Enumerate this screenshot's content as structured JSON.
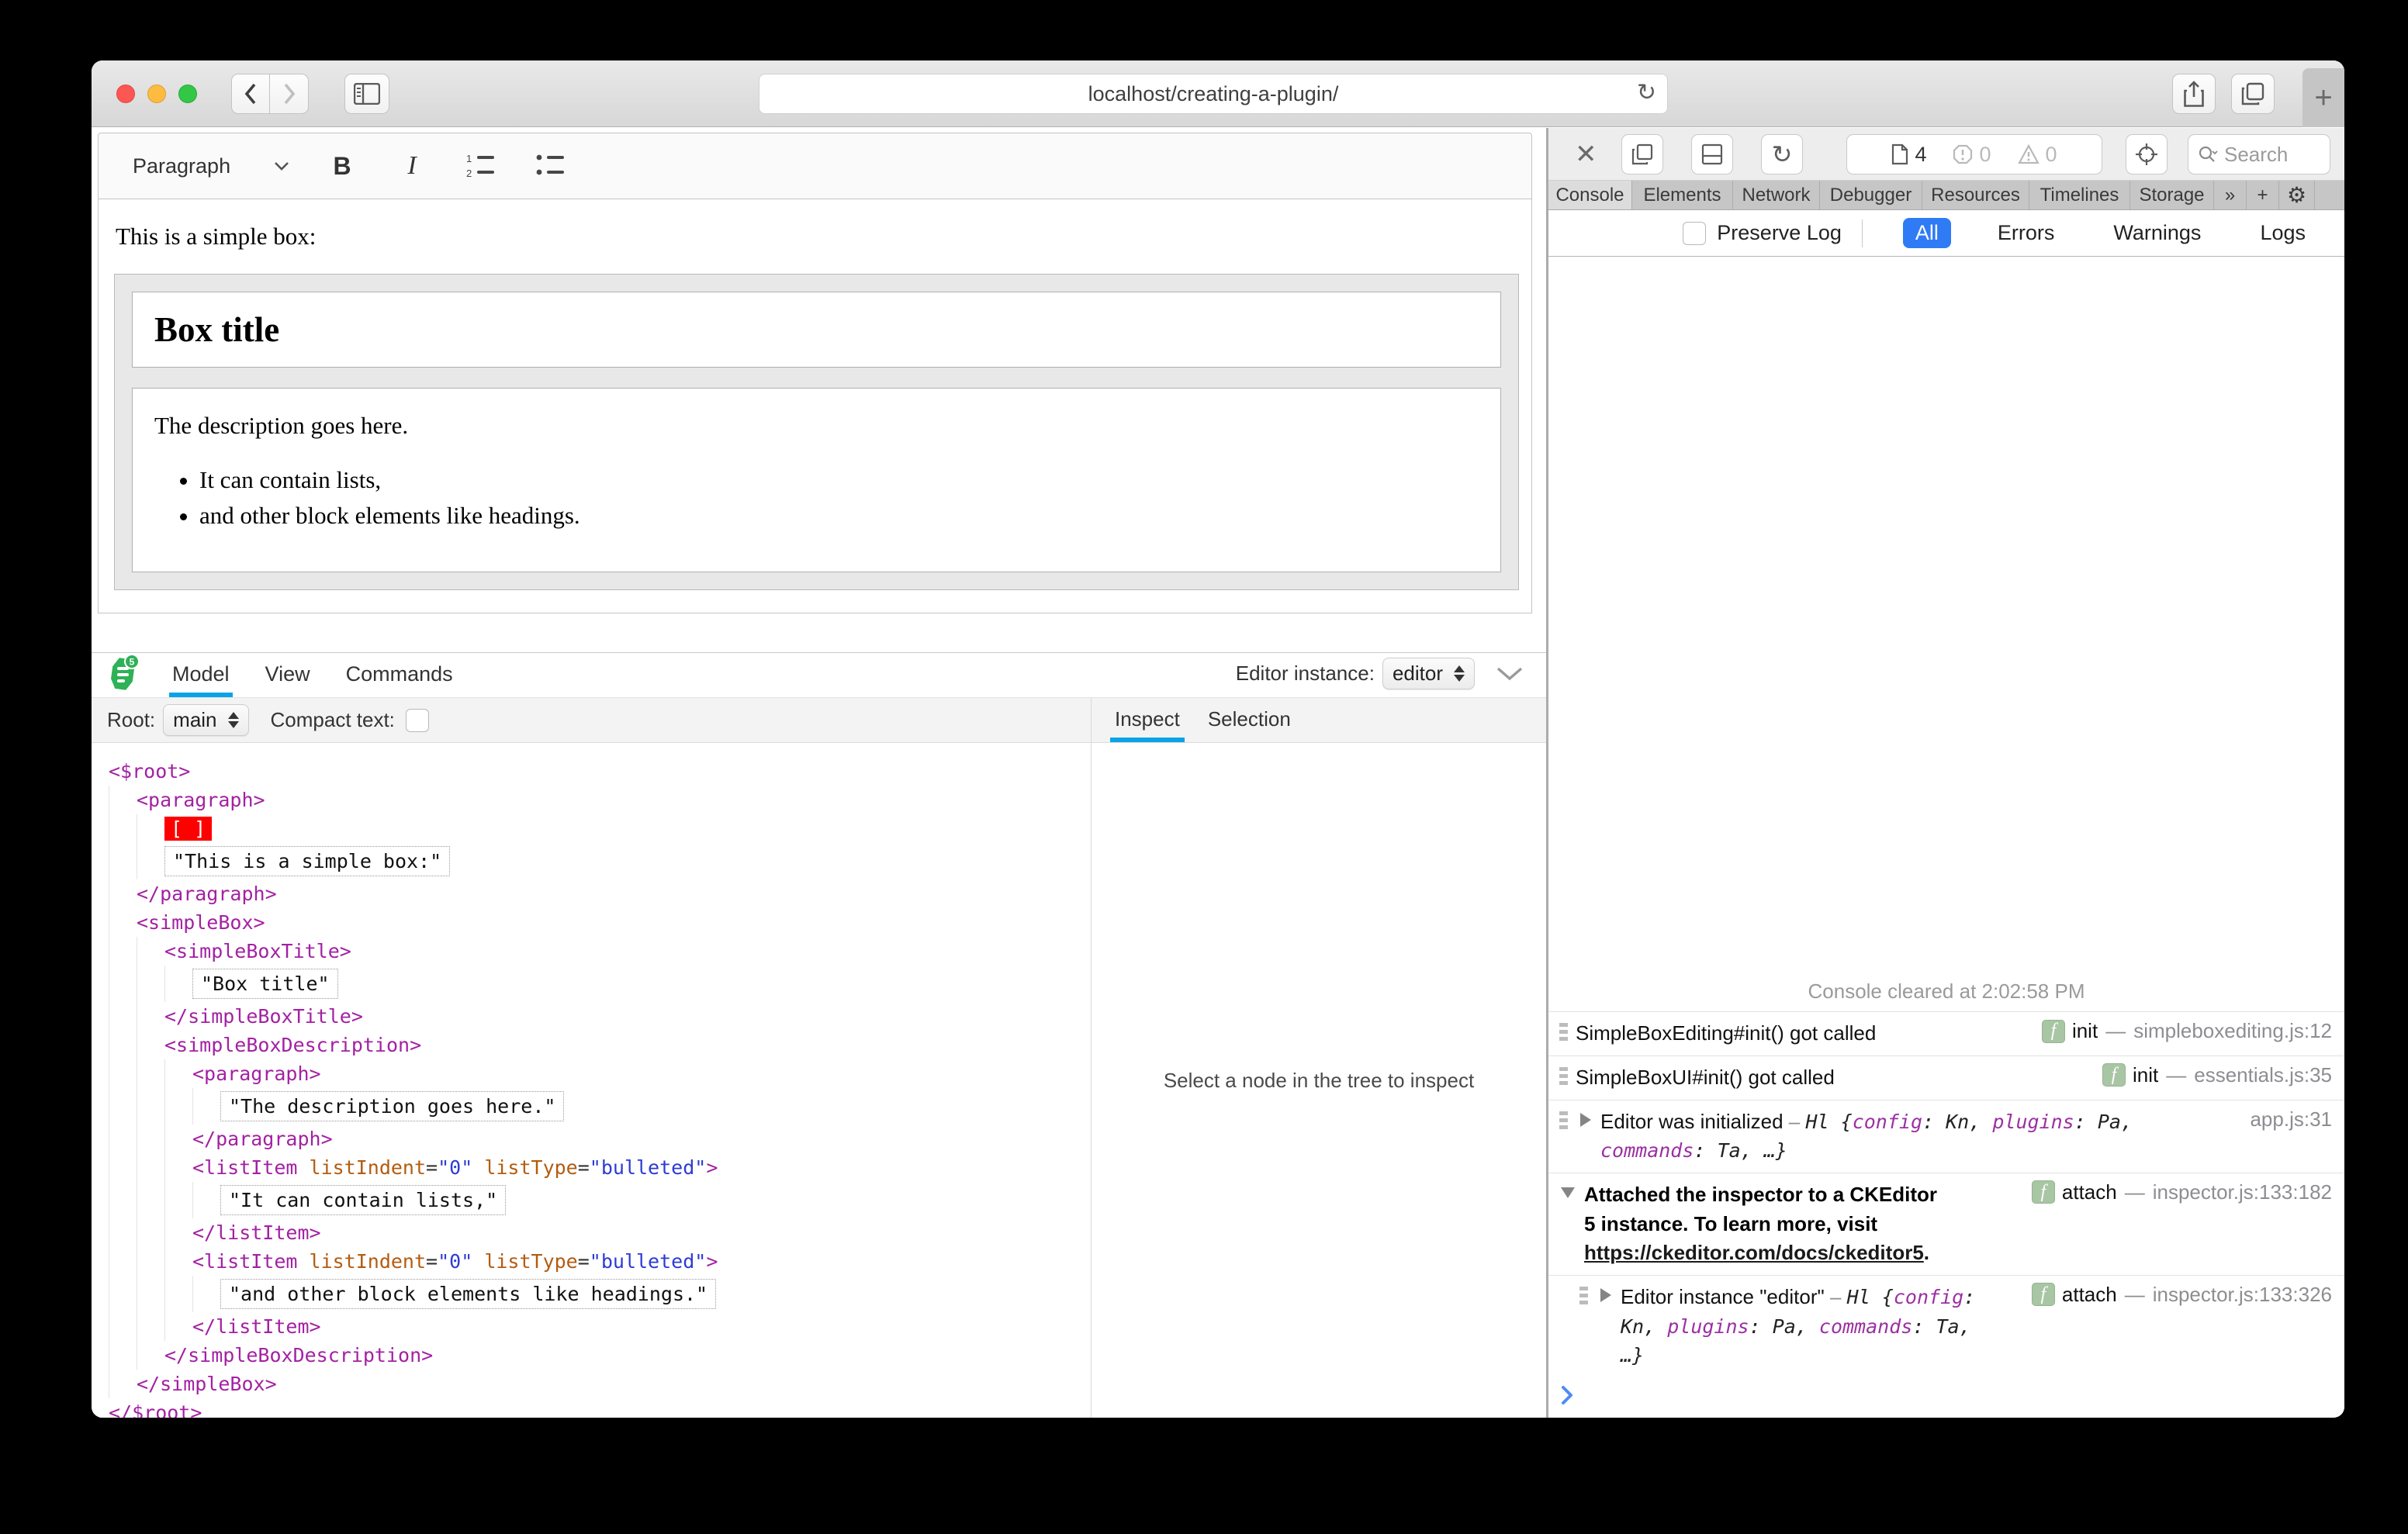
{
  "titlebar": {
    "url": "localhost/creating-a-plugin/",
    "new_tab_label": "+"
  },
  "colors": {
    "accent_blue": "#2f7bf5",
    "inspector_blue": "#0aa3e8",
    "selection_red": "#ff0000",
    "badge_green": "#a9c6a4",
    "ck_logo_green": "#2eb157",
    "traffic_red": "#fc5753",
    "traffic_yellow": "#fdbc40",
    "traffic_green": "#33c748"
  },
  "editor_toolbar": {
    "paragraph": "Paragraph",
    "bold": "B",
    "italic": "I"
  },
  "editor_content": {
    "intro": "This is a simple box:",
    "box_title": "Box title",
    "description": "The description goes here.",
    "list_items": [
      "It can contain lists,",
      "and other block elements like headings."
    ]
  },
  "ck_inspector": {
    "tabs": [
      {
        "label": "Model",
        "active": true
      },
      {
        "label": "View",
        "active": false
      },
      {
        "label": "Commands",
        "active": false
      }
    ],
    "editor_instance_label": "Editor instance:",
    "editor_instance_value": "editor",
    "root_label": "Root:",
    "root_value": "main",
    "compact_label": "Compact text:",
    "pane_tabs": [
      {
        "label": "Inspect",
        "active": true
      },
      {
        "label": "Selection",
        "active": false
      }
    ],
    "placeholder": "Select a node in the tree to inspect",
    "tree": [
      {
        "indent": 0,
        "seg": [
          [
            "tag",
            "<$root>"
          ]
        ]
      },
      {
        "indent": 1,
        "seg": [
          [
            "tag",
            "<paragraph>"
          ]
        ]
      },
      {
        "indent": 2,
        "seg": [
          [
            "sel",
            "[ ]"
          ]
        ]
      },
      {
        "indent": 2,
        "seg": [
          [
            "text",
            "\"This is a simple box:\""
          ]
        ]
      },
      {
        "indent": 1,
        "seg": [
          [
            "tag",
            "</paragraph>"
          ]
        ]
      },
      {
        "indent": 1,
        "seg": [
          [
            "tag",
            "<simpleBox>"
          ]
        ]
      },
      {
        "indent": 2,
        "seg": [
          [
            "tag",
            "<simpleBoxTitle>"
          ]
        ]
      },
      {
        "indent": 3,
        "seg": [
          [
            "text",
            "\"Box title\""
          ]
        ]
      },
      {
        "indent": 2,
        "seg": [
          [
            "tag",
            "</simpleBoxTitle>"
          ]
        ]
      },
      {
        "indent": 2,
        "seg": [
          [
            "tag",
            "<simpleBoxDescription>"
          ]
        ]
      },
      {
        "indent": 3,
        "seg": [
          [
            "tag",
            "<paragraph>"
          ]
        ]
      },
      {
        "indent": 4,
        "seg": [
          [
            "text",
            "\"The description goes here.\""
          ]
        ]
      },
      {
        "indent": 3,
        "seg": [
          [
            "tag",
            "</paragraph>"
          ]
        ]
      },
      {
        "indent": 3,
        "seg": [
          [
            "tag",
            "<listItem "
          ],
          [
            "attr",
            "listIndent"
          ],
          [
            "eq",
            "="
          ],
          [
            "val",
            "\"0\""
          ],
          [
            "plain",
            " "
          ],
          [
            "attr",
            "listType"
          ],
          [
            "eq",
            "="
          ],
          [
            "val",
            "\"bulleted\""
          ],
          [
            "tag",
            ">"
          ]
        ]
      },
      {
        "indent": 4,
        "seg": [
          [
            "text",
            "\"It can contain lists,\""
          ]
        ]
      },
      {
        "indent": 3,
        "seg": [
          [
            "tag",
            "</listItem>"
          ]
        ]
      },
      {
        "indent": 3,
        "seg": [
          [
            "tag",
            "<listItem "
          ],
          [
            "attr",
            "listIndent"
          ],
          [
            "eq",
            "="
          ],
          [
            "val",
            "\"0\""
          ],
          [
            "plain",
            " "
          ],
          [
            "attr",
            "listType"
          ],
          [
            "eq",
            "="
          ],
          [
            "val",
            "\"bulleted\""
          ],
          [
            "tag",
            ">"
          ]
        ]
      },
      {
        "indent": 4,
        "seg": [
          [
            "text",
            "\"and other block elements like headings.\""
          ]
        ]
      },
      {
        "indent": 3,
        "seg": [
          [
            "tag",
            "</listItem>"
          ]
        ]
      },
      {
        "indent": 2,
        "seg": [
          [
            "tag",
            "</simpleBoxDescription>"
          ]
        ]
      },
      {
        "indent": 1,
        "seg": [
          [
            "tag",
            "</simpleBox>"
          ]
        ]
      },
      {
        "indent": 0,
        "seg": [
          [
            "tag",
            "</$root>"
          ]
        ]
      }
    ]
  },
  "web_inspector": {
    "toolbar": {
      "page_count": "4",
      "error_count": "0",
      "warning_count": "0",
      "search_placeholder": "Search"
    },
    "tabs": [
      {
        "label": "Console",
        "active": true,
        "w": 108
      },
      {
        "label": "Elements",
        "active": false,
        "w": 130
      },
      {
        "label": "Network",
        "active": false,
        "w": 112
      },
      {
        "label": "Debugger",
        "active": false,
        "w": 132
      },
      {
        "label": "Resources",
        "active": false,
        "w": 138
      },
      {
        "label": "Timelines",
        "active": false,
        "w": 130
      },
      {
        "label": "Storage",
        "active": false,
        "w": 108
      },
      {
        "label": "»",
        "active": false,
        "w": 42
      },
      {
        "label": "+",
        "active": false,
        "w": 42
      },
      {
        "label": "⚙",
        "active": false,
        "w": 46
      }
    ],
    "filter": {
      "preserve_log": "Preserve Log",
      "scopes": [
        {
          "label": "All",
          "active": true
        },
        {
          "label": "Errors",
          "active": false
        },
        {
          "label": "Warnings",
          "active": false
        },
        {
          "label": "Logs",
          "active": false
        }
      ]
    },
    "cleared": "Console cleared at 2:02:58 PM",
    "messages": [
      {
        "type": "plain",
        "text": "SimpleBoxEditing#init() got called",
        "badge": "init",
        "source": "simpleboxediting.js:12"
      },
      {
        "type": "plain",
        "text": "SimpleBoxUI#init() got called",
        "badge": "init",
        "source": "essentials.js:35"
      },
      {
        "type": "object",
        "arrow": "collapsed",
        "parts": [
          [
            "t",
            "Editor was initialized"
          ],
          [
            "d",
            " – "
          ],
          [
            "o",
            "Hl "
          ],
          [
            "b",
            "{"
          ],
          [
            "k",
            "config"
          ],
          [
            "b",
            ": "
          ],
          [
            "v",
            "Kn"
          ],
          [
            "b",
            ", "
          ],
          [
            "k",
            "plugins"
          ],
          [
            "b",
            ": "
          ],
          [
            "v",
            "Pa"
          ],
          [
            "b",
            ", "
          ],
          [
            "k",
            "commands"
          ],
          [
            "b",
            ": "
          ],
          [
            "v",
            "Ta"
          ],
          [
            "b",
            ", …}"
          ]
        ],
        "badge": null,
        "source": "app.js:31"
      },
      {
        "type": "group",
        "arrow": "expanded",
        "text": "Attached the inspector to a CKEditor 5 instance. To learn more, visit",
        "link": "https://ckeditor.com/docs/ckeditor5",
        "after": ".",
        "badge": "attach",
        "source": "inspector.js:133:182"
      },
      {
        "type": "object",
        "nested": true,
        "arrow": "collapsed",
        "parts": [
          [
            "t",
            "Editor instance \"editor\""
          ],
          [
            "d",
            " – "
          ],
          [
            "o",
            "Hl "
          ],
          [
            "b",
            "{"
          ],
          [
            "k",
            "config"
          ],
          [
            "b",
            ": "
          ],
          [
            "v",
            "Kn"
          ],
          [
            "b",
            ", "
          ],
          [
            "k",
            "plugins"
          ],
          [
            "b",
            ": "
          ],
          [
            "v",
            "Pa"
          ],
          [
            "b",
            ", "
          ],
          [
            "k",
            "commands"
          ],
          [
            "b",
            ": "
          ],
          [
            "v",
            "Ta"
          ],
          [
            "b",
            ", …}"
          ]
        ],
        "badge": "attach",
        "source": "inspector.js:133:326"
      }
    ]
  }
}
